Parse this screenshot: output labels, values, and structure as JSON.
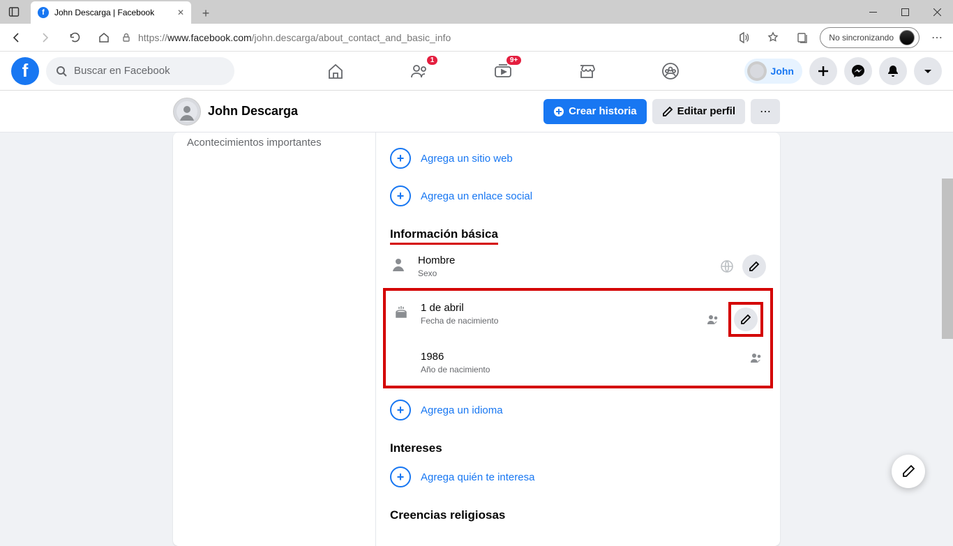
{
  "browser": {
    "tab_title": "John Descarga | Facebook",
    "url_prefix": "https://",
    "url_domain": "www.facebook.com",
    "url_path": "/john.descarga/about_contact_and_basic_info",
    "sync_label": "No sincronizando"
  },
  "topbar": {
    "search_placeholder": "Buscar en Facebook",
    "badges": {
      "friends": "1",
      "watch": "9+"
    },
    "user_short": "John"
  },
  "profile": {
    "name": "John Descarga",
    "btn_story": "Crear historia",
    "btn_edit": "Editar perfil"
  },
  "left": {
    "item_cut": "Acontecimientos importantes"
  },
  "sections": {
    "add_website": "Agrega un sitio web",
    "add_social": "Agrega un enlace social",
    "basic_info": "Información básica",
    "gender_val": "Hombre",
    "gender_lbl": "Sexo",
    "birthdate_val": "1 de abril",
    "birthdate_lbl": "Fecha de nacimiento",
    "birthyear_val": "1986",
    "birthyear_lbl": "Año de nacimiento",
    "add_language": "Agrega un idioma",
    "interests": "Intereses",
    "add_interests": "Agrega quién te interesa",
    "beliefs": "Creencias religiosas"
  }
}
